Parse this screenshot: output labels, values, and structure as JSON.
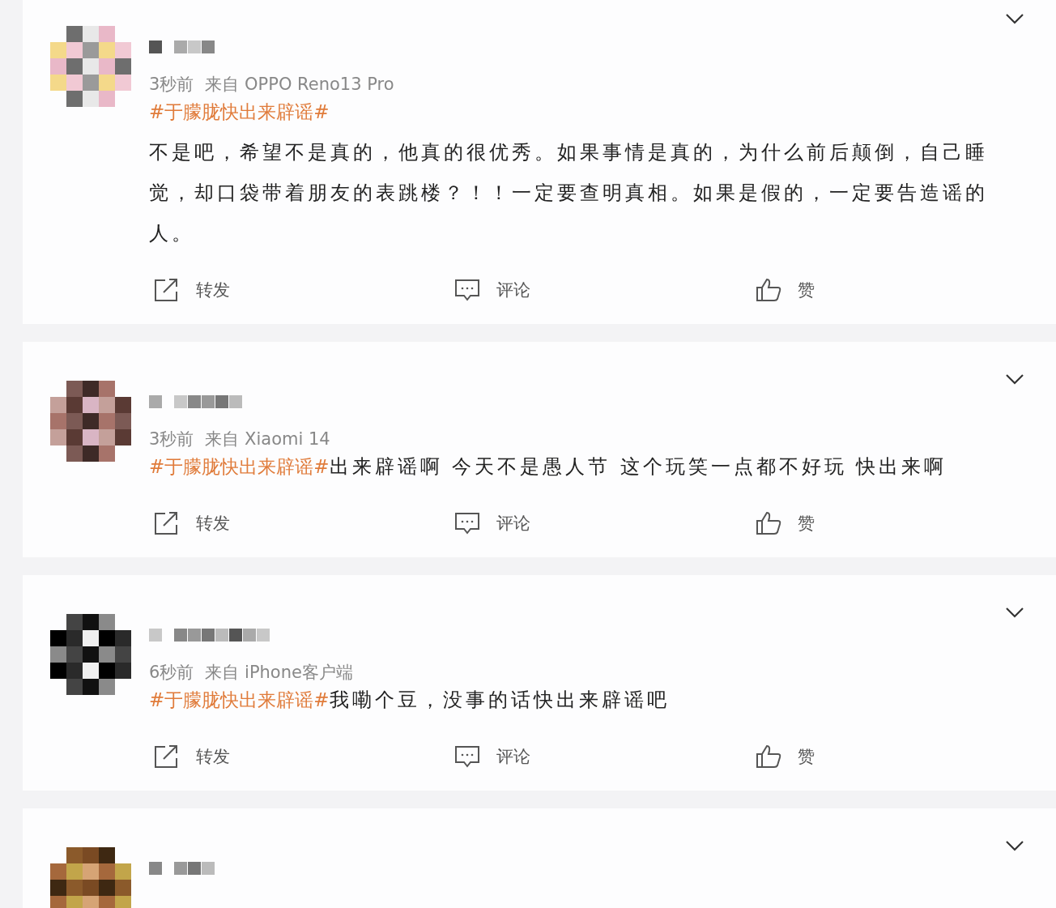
{
  "posts": [
    {
      "kind": "post",
      "time": "3秒前",
      "source": "来自 OPPO Reno13 Pro",
      "content": [
        {
          "kind": "hashtag",
          "text": "#于朦胧快出来辟谣#"
        },
        {
          "kind": "break"
        },
        {
          "kind": "text",
          "text": "不是吧，希望不是真的，他真的很优秀。如果事情是真的，为什么前后颠倒，自己睡觉，却口袋带着朋友的表跳楼？！！一定要查明真相。如果是假的，一定要告造谣的人。"
        }
      ],
      "actions": [
        {
          "kind": "repost",
          "label": "转发"
        },
        {
          "kind": "comment",
          "label": "评论"
        },
        {
          "kind": "like",
          "label": "赞"
        }
      ]
    },
    {
      "kind": "post",
      "time": "3秒前",
      "source": "来自 Xiaomi 14",
      "content": [
        {
          "kind": "hashtag",
          "text": "#于朦胧快出来辟谣#"
        },
        {
          "kind": "text",
          "text": "出来辟谣啊 今天不是愚人节 这个玩笑一点都不好玩 快出来啊"
        }
      ],
      "actions": [
        {
          "kind": "repost",
          "label": "转发"
        },
        {
          "kind": "comment",
          "label": "评论"
        },
        {
          "kind": "like",
          "label": "赞"
        }
      ]
    },
    {
      "kind": "post",
      "time": "6秒前",
      "source": "来自 iPhone客户端",
      "content": [
        {
          "kind": "hashtag",
          "text": "#于朦胧快出来辟谣#"
        },
        {
          "kind": "text",
          "text": "我嘞个豆，没事的话快出来辟谣吧"
        }
      ],
      "actions": [
        {
          "kind": "repost",
          "label": "转发"
        },
        {
          "kind": "comment",
          "label": "评论"
        },
        {
          "kind": "like",
          "label": "赞"
        }
      ]
    },
    {
      "kind": "cut"
    }
  ]
}
